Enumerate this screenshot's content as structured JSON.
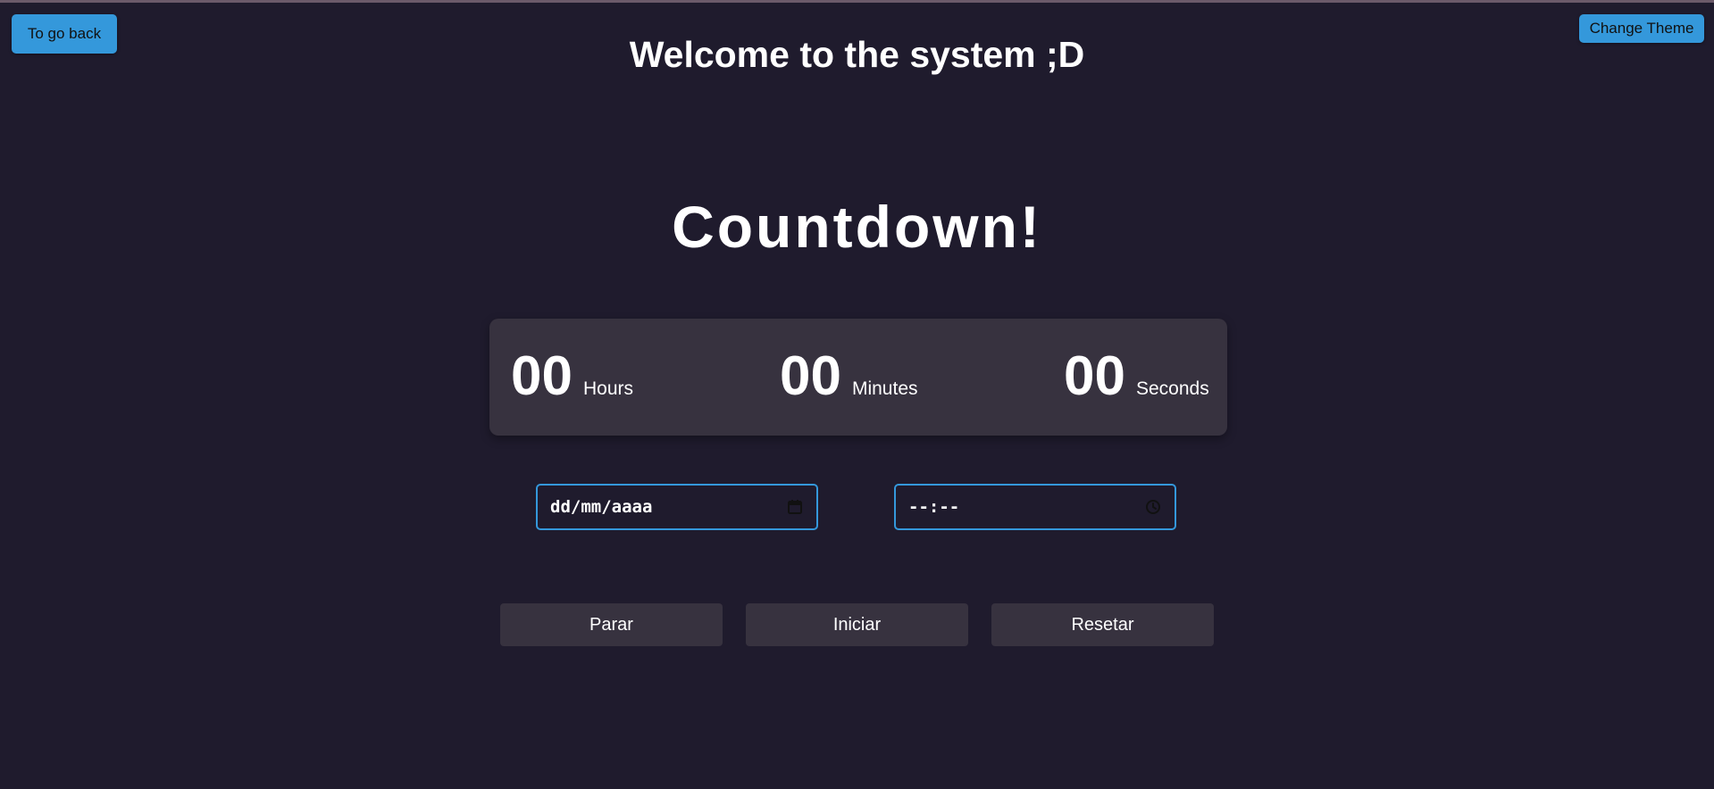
{
  "header": {
    "back_label": "To go back",
    "theme_label": "Change Theme",
    "welcome": "Welcome to the system ;D"
  },
  "main": {
    "title": "Countdown!",
    "timer": {
      "hours": "00",
      "hours_label": "Hours",
      "minutes": "00",
      "minutes_label": "Minutes",
      "seconds": "00",
      "seconds_label": "Seconds"
    },
    "date_input": {
      "value": "dd/mm/aaaa",
      "icon": "calendar-icon"
    },
    "time_input": {
      "value": "--:--",
      "icon": "clock-icon"
    },
    "buttons": {
      "stop": "Parar",
      "start": "Iniciar",
      "reset": "Resetar"
    }
  },
  "colors": {
    "background": "#1f1b2d",
    "panel": "#37323f",
    "accent": "#3498db",
    "text": "#ffffff"
  }
}
